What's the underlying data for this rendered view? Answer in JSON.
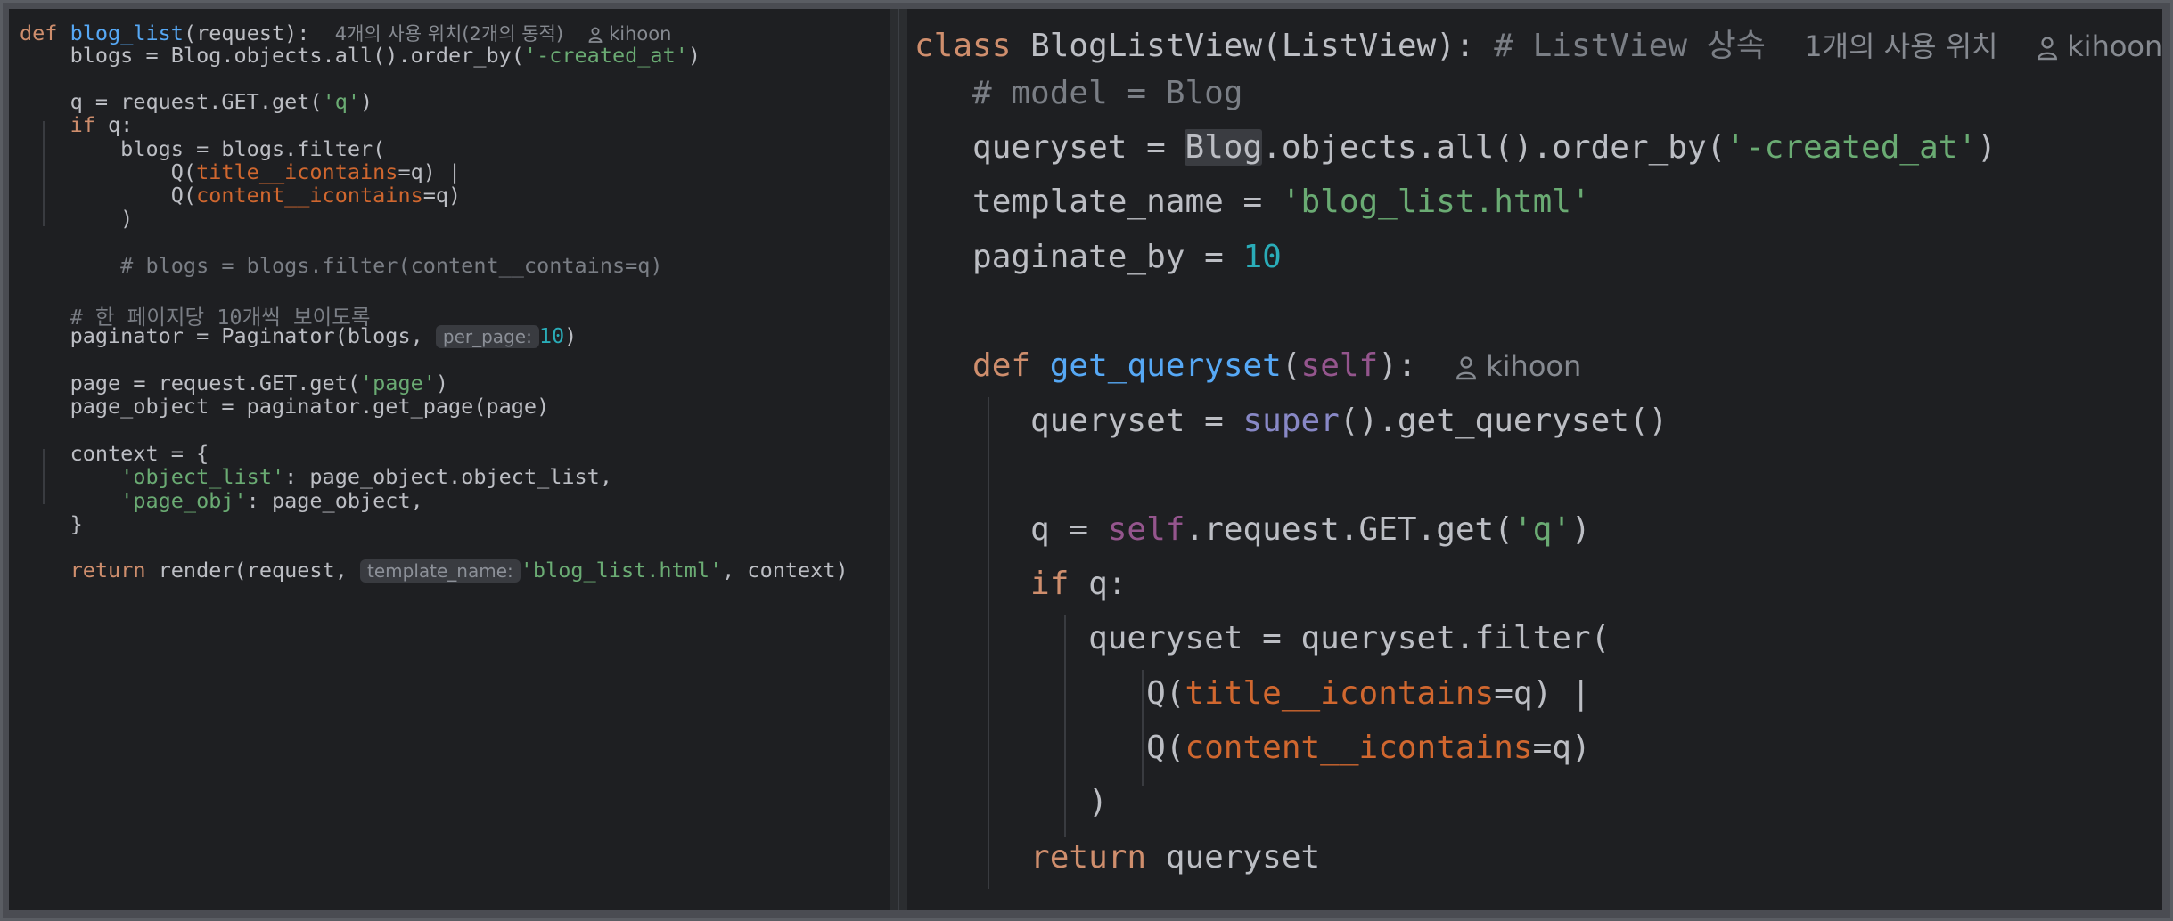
{
  "left": {
    "func_kw": "def",
    "func_name": "blog_list",
    "func_params": "(request):",
    "usage_hint": "4개의 사용 위치(2개의 동적)",
    "author": "kihoon",
    "lines": {
      "l2": [
        "    blogs = Blog.objects.all().order_by(",
        "'-created_at'",
        ")"
      ],
      "l4a": "    q = request.GET.get(",
      "l4b": "'q'",
      "l4c": ")",
      "l5kw": "if",
      "l5": " q:",
      "l6": "        blogs = blogs.filter(",
      "l7a": "            Q(",
      "l7b": "title__icontains",
      "l7c": "=q) |",
      "l8a": "            Q(",
      "l8b": "content__icontains",
      "l8c": "=q)",
      "l9": "        )",
      "l11": "        # blogs = blogs.filter(content__contains=q)",
      "l13": "    # 한 페이지당 10개씩 보이도록",
      "l14a": "    paginator = Paginator(blogs, ",
      "l14hint": "per_page:",
      "l14num": "10",
      "l14c": ")",
      "l16a": "    page = request.GET.get(",
      "l16b": "'page'",
      "l16c": ")",
      "l17": "    page_object = paginator.get_page(page)",
      "l19": "    context = {",
      "l20a": "'object_list'",
      "l20b": ": page_object.object_list,",
      "l21a": "'page_obj'",
      "l21b": ": page_object,",
      "l22": "    }",
      "l24kw": "return",
      "l24a": " render(request, ",
      "l24hint": "template_name:",
      "l24b": "'blog_list.html'",
      "l24c": ", context)"
    }
  },
  "right": {
    "class_kw": "class",
    "class_decl": "BlogListView(ListView):",
    "class_comment": "# ListView 상속",
    "usage_hint": "1개의 사용 위치",
    "author": "kihoon",
    "lines": {
      "r2": "# model = Blog",
      "r3a": "queryset = ",
      "r3b": "Blog",
      "r3c": ".objects.all().order_by(",
      "r3d": "'-created_at'",
      "r3e": ")",
      "r4a": "template_name = ",
      "r4b": "'blog_list.html'",
      "r5a": "paginate_by = ",
      "r5b": "10",
      "r7kw": "def",
      "r7fn": "get_queryset",
      "r7self": "self",
      "r8a": "queryset = ",
      "r8b": "super",
      "r8c": "().get_queryset()",
      "r10a": "q = ",
      "r10b": "self",
      "r10c": ".request.GET.get(",
      "r10d": "'q'",
      "r10e": ")",
      "r11kw": "if",
      "r11": " q:",
      "r12": "queryset = queryset.filter(",
      "r13a": "Q(",
      "r13b": "title__icontains",
      "r13c": "=q) |",
      "r14a": "Q(",
      "r14b": "content__icontains",
      "r14c": "=q)",
      "r15": ")",
      "r16kw": "return",
      "r16": " queryset"
    }
  }
}
